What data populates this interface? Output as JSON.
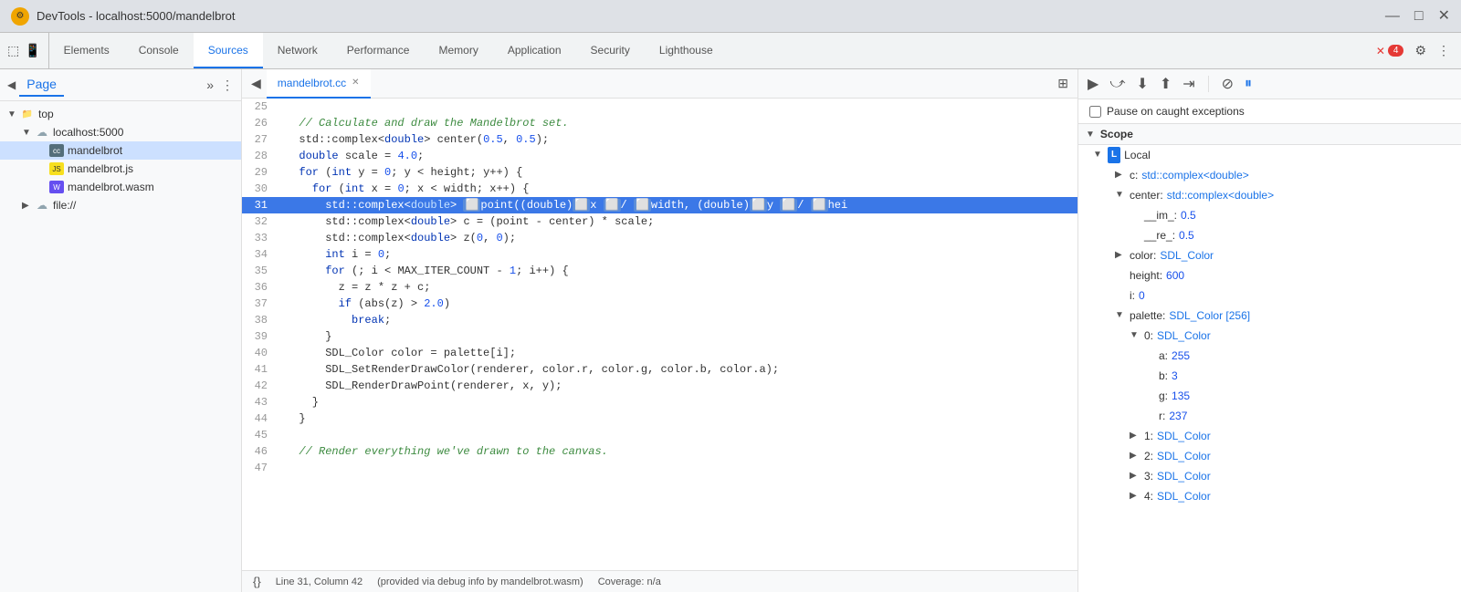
{
  "titleBar": {
    "title": "DevTools - localhost:5000/mandelbrot",
    "icon": "⚙",
    "minimize": "—",
    "maximize": "□",
    "close": "✕"
  },
  "tabs": [
    {
      "label": "Elements",
      "active": false
    },
    {
      "label": "Console",
      "active": false
    },
    {
      "label": "Sources",
      "active": true
    },
    {
      "label": "Network",
      "active": false
    },
    {
      "label": "Performance",
      "active": false
    },
    {
      "label": "Memory",
      "active": false
    },
    {
      "label": "Application",
      "active": false
    },
    {
      "label": "Security",
      "active": false
    },
    {
      "label": "Lighthouse",
      "active": false
    }
  ],
  "badgeCount": "4",
  "sidebar": {
    "pageTab": "Page",
    "moreTabsIcon": "»",
    "tree": [
      {
        "level": 1,
        "type": "folder-open",
        "label": "top",
        "arrow": "▼"
      },
      {
        "level": 2,
        "type": "cloud",
        "label": "localhost:5000",
        "arrow": "▼"
      },
      {
        "level": 3,
        "type": "file-cc",
        "label": "mandelbrot",
        "selected": true
      },
      {
        "level": 3,
        "type": "file-js",
        "label": "mandelbrot.js"
      },
      {
        "level": 3,
        "type": "file-wasm",
        "label": "mandelbrot.wasm"
      },
      {
        "level": 2,
        "type": "cloud",
        "label": "file://",
        "arrow": "▶"
      }
    ]
  },
  "editor": {
    "tab": "mandelbrot.cc",
    "lines": [
      {
        "num": 25,
        "content": ""
      },
      {
        "num": 26,
        "content": "  // Calculate and draw the Mandelbrot set.",
        "isComment": true
      },
      {
        "num": 27,
        "content": "  std::complex<double> center(0.5, 0.5);"
      },
      {
        "num": 28,
        "content": "  double scale = 4.0;"
      },
      {
        "num": 29,
        "content": "  for (int y = 0; y < height; y++) {"
      },
      {
        "num": 30,
        "content": "    for (int x = 0; x < width; x++) {"
      },
      {
        "num": 31,
        "content": "      std::complex<double> point((double)x / width, (double)y / hei",
        "highlighted": true
      },
      {
        "num": 32,
        "content": "      std::complex<double> c = (point - center) * scale;"
      },
      {
        "num": 33,
        "content": "      std::complex<double> z(0, 0);"
      },
      {
        "num": 34,
        "content": "      int i = 0;"
      },
      {
        "num": 35,
        "content": "      for (; i < MAX_ITER_COUNT - 1; i++) {"
      },
      {
        "num": 36,
        "content": "        z = z * z + c;"
      },
      {
        "num": 37,
        "content": "        if (abs(z) > 2.0)"
      },
      {
        "num": 38,
        "content": "          break;"
      },
      {
        "num": 39,
        "content": "      }"
      },
      {
        "num": 40,
        "content": "      SDL_Color color = palette[i];"
      },
      {
        "num": 41,
        "content": "      SDL_SetRenderDrawColor(renderer, color.r, color.g, color.b, color.a);"
      },
      {
        "num": 42,
        "content": "      SDL_RenderDrawPoint(renderer, x, y);"
      },
      {
        "num": 43,
        "content": "    }"
      },
      {
        "num": 44,
        "content": "  }"
      },
      {
        "num": 45,
        "content": ""
      },
      {
        "num": 46,
        "content": "  // Render everything we've drawn to the canvas.",
        "isComment": true
      },
      {
        "num": 47,
        "content": ""
      }
    ]
  },
  "statusBar": {
    "lineCol": "Line 31, Column 42",
    "debugInfo": "(provided via debug info by mandelbrot.wasm)",
    "coverage": "Coverage: n/a"
  },
  "debugPanel": {
    "pauseExceptions": "Pause on caught exceptions",
    "scopeLabel": "Scope",
    "localLabel": "Local",
    "scope": [
      {
        "key": "c:",
        "val": " std::complex<double>",
        "level": 1,
        "expandable": true
      },
      {
        "key": "center:",
        "val": " std::complex<double>",
        "level": 1,
        "expandable": true,
        "expanded": true
      },
      {
        "key": "__im_:",
        "val": " 0.5",
        "level": 2,
        "valType": "num"
      },
      {
        "key": "__re_:",
        "val": " 0.5",
        "level": 2,
        "valType": "num"
      },
      {
        "key": "color:",
        "val": " SDL_Color",
        "level": 1,
        "expandable": true
      },
      {
        "key": "height:",
        "val": " 600",
        "level": 1,
        "valType": "num"
      },
      {
        "key": "i:",
        "val": " 0",
        "level": 1,
        "valType": "num"
      },
      {
        "key": "palette:",
        "val": " SDL_Color [256]",
        "level": 1,
        "expandable": true,
        "expanded": true
      },
      {
        "key": "▼ 0:",
        "val": " SDL_Color",
        "level": 2,
        "expandable": true,
        "expanded": true
      },
      {
        "key": "a:",
        "val": " 255",
        "level": 3,
        "valType": "num"
      },
      {
        "key": "b:",
        "val": " 3",
        "level": 3,
        "valType": "num"
      },
      {
        "key": "g:",
        "val": " 135",
        "level": 3,
        "valType": "num"
      },
      {
        "key": "r:",
        "val": " 237",
        "level": 3,
        "valType": "num"
      },
      {
        "key": "▶ 1:",
        "val": " SDL_Color",
        "level": 2
      },
      {
        "key": "▶ 2:",
        "val": " SDL_Color",
        "level": 2
      },
      {
        "key": "▶ 3:",
        "val": " SDL_Color",
        "level": 2
      },
      {
        "key": "▶ 4:",
        "val": " SDL_Color",
        "level": 2
      }
    ]
  }
}
